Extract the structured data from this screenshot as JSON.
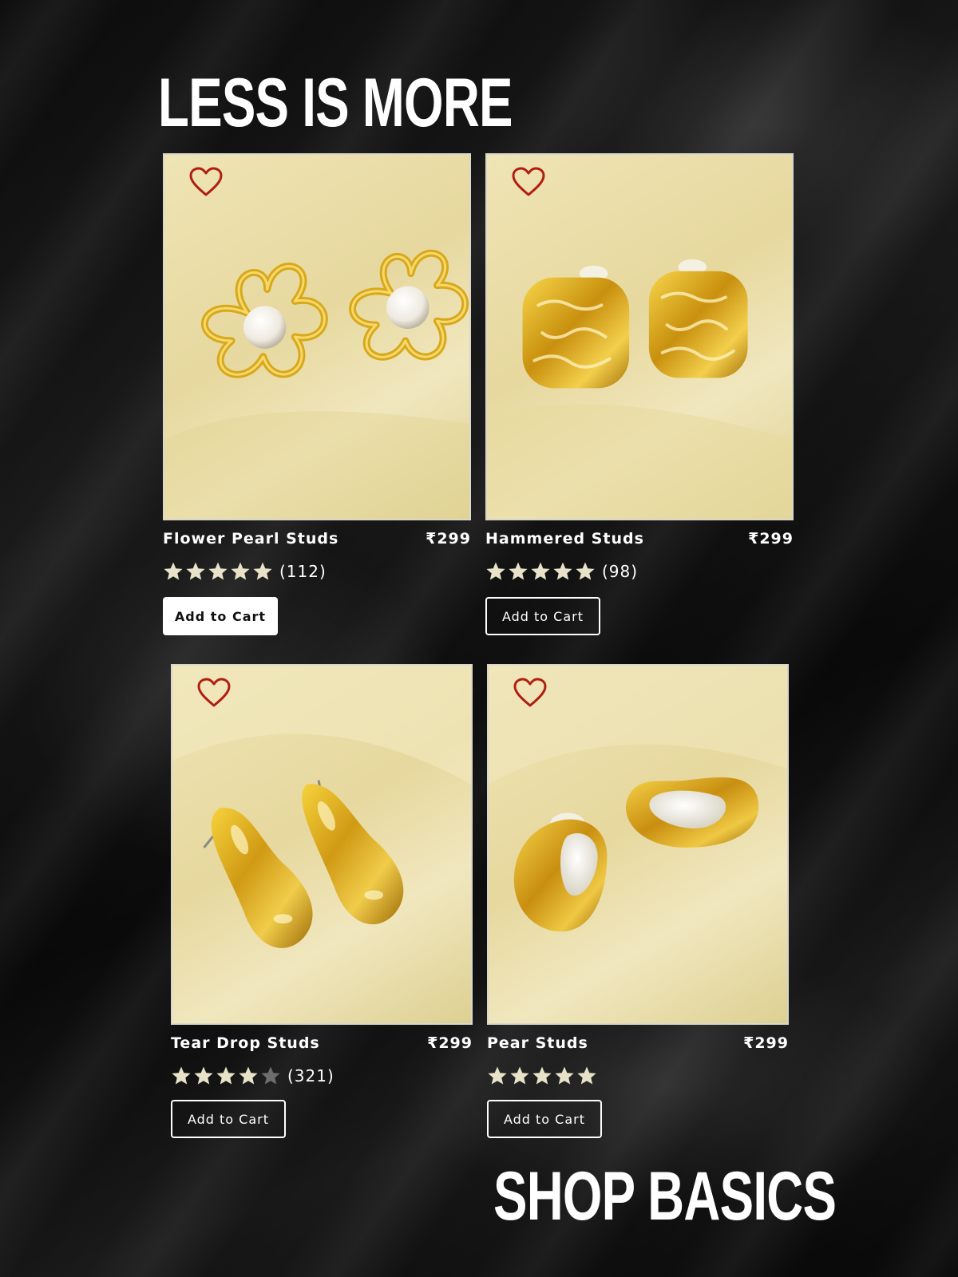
{
  "headings": {
    "top": "LESS IS MORE",
    "bottom": "SHOP BASICS"
  },
  "colors": {
    "background": "#111111",
    "text": "#ffffff",
    "heart": "#b01e10",
    "star_filled": "#e8e3c8",
    "star_empty": "#6e6e6e",
    "photo_gold": "#e9dca6"
  },
  "products": [
    {
      "name": "Flower Pearl Studs",
      "price": "₹299",
      "rating": 5,
      "review_count": "(112)",
      "cart_label": "Add to Cart",
      "cart_style": "filled",
      "wishlist_icon": "heart-outline-icon"
    },
    {
      "name": "Hammered Studs",
      "price": "₹299",
      "rating": 5,
      "review_count": "(98)",
      "cart_label": "Add to Cart",
      "cart_style": "outline",
      "wishlist_icon": "heart-outline-icon"
    },
    {
      "name": "Tear Drop Studs",
      "price": "₹299",
      "rating": 4,
      "review_count": "(321)",
      "cart_label": "Add to Cart",
      "cart_style": "outline",
      "wishlist_icon": "heart-outline-icon"
    },
    {
      "name": "Pear Studs",
      "price": "₹299",
      "rating": 5,
      "review_count": "",
      "cart_label": "Add to Cart",
      "cart_style": "outline",
      "wishlist_icon": "heart-outline-icon"
    }
  ]
}
